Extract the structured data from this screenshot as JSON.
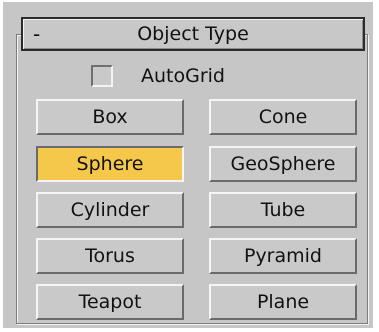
{
  "rollout": {
    "collapse_symbol": "-",
    "title": "Object Type"
  },
  "autogrid": {
    "label": "AutoGrid",
    "checked": false
  },
  "buttons": {
    "box": "Box",
    "cone": "Cone",
    "sphere": "Sphere",
    "geosphere": "GeoSphere",
    "cylinder": "Cylinder",
    "tube": "Tube",
    "torus": "Torus",
    "pyramid": "Pyramid",
    "teapot": "Teapot",
    "plane": "Plane"
  },
  "selected_button": "Sphere",
  "colors": {
    "panel_bg": "#c6c6c6",
    "active_button": "#f5c84b"
  }
}
